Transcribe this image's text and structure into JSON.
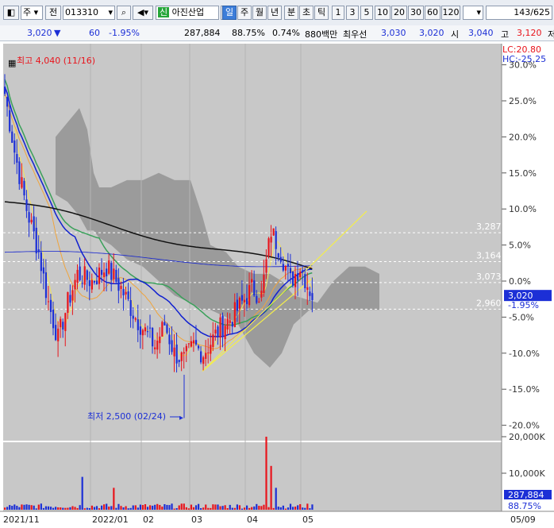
{
  "toolbar": {
    "market": "주",
    "kind": "전",
    "code": "013310",
    "badge": "신",
    "name": "아진산업",
    "periods": [
      "일",
      "주",
      "월",
      "년",
      "분",
      "초",
      "틱"
    ],
    "active_period": "일",
    "minutes": [
      "1",
      "3",
      "5",
      "10",
      "20",
      "30",
      "60",
      "120"
    ],
    "count": "143/625"
  },
  "info": {
    "price": "3,020",
    "arrow": "▼",
    "change": "60",
    "change_pct": "-1.95%",
    "volume": "287,884",
    "vol_ratio": "88.75%",
    "turnover": "0.74%",
    "amount": "880백만",
    "priority_label": "최우선",
    "ask": "3,030",
    "bid": "3,020",
    "open_label": "시",
    "open": "3,040",
    "high_label": "고",
    "high": "3,120",
    "trail": "저"
  },
  "colors": {
    "up": "#e8141c",
    "down": "#1c2fd6",
    "ma_short": "#f2e05a",
    "ma_mid": "#f0a43c",
    "ma_60": "#3aa05a",
    "ma_120": "#1020d0",
    "ma_240": "#111111",
    "cloud": "#8c8c8c",
    "trend": "#f4ee4a",
    "chart_bg": "#c8c8c8"
  },
  "chart_data": {
    "type": "candlestick",
    "x_labels": [
      "2021/11",
      "2022/01",
      "02",
      "03",
      "04",
      "05",
      "05/09"
    ],
    "y_ticks": [
      "30.0%",
      "25.0%",
      "20.0%",
      "15.0%",
      "10.0%",
      "5.0%",
      "0.0%",
      "-5.0%",
      "-10.0%",
      "-15.0%",
      "-20.0%"
    ],
    "y_range_pct": [
      -22,
      30
    ],
    "reference_price": 3080,
    "current_price_label": "3,020",
    "current_pct_label": "-1.95%",
    "hc_labels": [
      "LC:20.80",
      "HC:-25.25"
    ],
    "high_annotation": "최고 4,040 (11/16)",
    "low_annotation": "최저 2,500 (02/24)",
    "levels": [
      {
        "label": "3,287",
        "pct": 6.7
      },
      {
        "label": "3,164",
        "pct": 2.7
      },
      {
        "label": "3,073",
        "pct": -0.2
      },
      {
        "label": "2,960",
        "pct": -3.9
      }
    ],
    "volume_ticks": [
      "20,000K",
      "10,000K"
    ],
    "volume_last": "287,884",
    "volume_pct": "88.75%"
  }
}
